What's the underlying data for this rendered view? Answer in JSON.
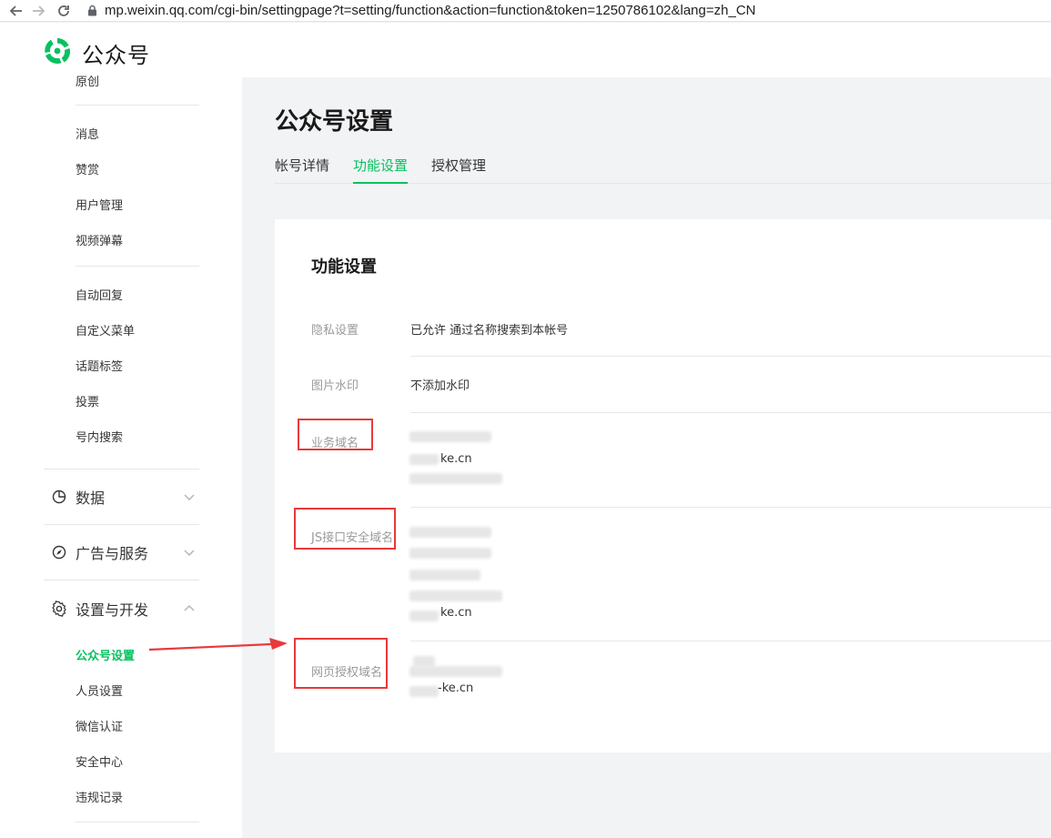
{
  "browser": {
    "url": "mp.weixin.qq.com/cgi-bin/settingpage?t=setting/function&action=function&token=1250786102&lang=zh_CN"
  },
  "header": {
    "logo_text": "公众号"
  },
  "sidebar": {
    "top_cut_item": "原创",
    "items_a": [
      "消息",
      "赞赏",
      "用户管理",
      "视频弹幕"
    ],
    "items_b": [
      "自动回复",
      "自定义菜单",
      "话题标签",
      "投票",
      "号内搜索"
    ],
    "groups": [
      {
        "label": "数据",
        "icon": "pie-chart-icon",
        "state": "collapsed"
      },
      {
        "label": "广告与服务",
        "icon": "compass-icon",
        "state": "collapsed"
      },
      {
        "label": "设置与开发",
        "icon": "gear-icon",
        "state": "expanded"
      }
    ],
    "settings_items": [
      "公众号设置",
      "人员设置",
      "微信认证",
      "安全中心",
      "违规记录"
    ],
    "active_item": "公众号设置"
  },
  "main": {
    "page_title": "公众号设置",
    "tabs": [
      "帐号详情",
      "功能设置",
      "授权管理"
    ],
    "active_tab": "功能设置",
    "card_title": "功能设置",
    "rows": {
      "privacy": {
        "label": "隐私设置",
        "value": "已允许 通过名称搜索到本帐号"
      },
      "watermark": {
        "label": "图片水印",
        "value": "不添加水印"
      },
      "business_domain": {
        "label": "业务域名",
        "visible_domain": "ke.cn"
      },
      "js_domain": {
        "label": "JS接口安全域名",
        "visible_domain": "ke.cn"
      },
      "oauth_domain": {
        "label": "网页授权域名",
        "visible_domain": "-ke.cn"
      }
    }
  },
  "colors": {
    "accent": "#07c160",
    "annotation": "#e83a3a"
  }
}
